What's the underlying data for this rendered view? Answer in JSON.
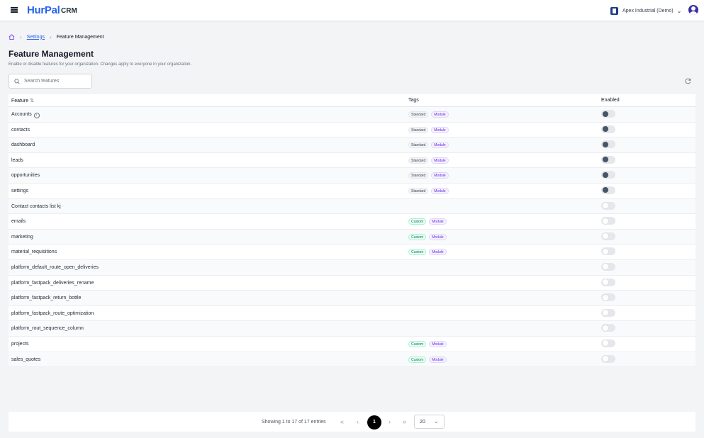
{
  "app": {
    "logo": "HurPal",
    "logo_suffix": "CRM"
  },
  "header": {
    "org_name": "Apex Industrial (Demo)"
  },
  "breadcrumb": {
    "settings": "Settings",
    "current": "Feature Management"
  },
  "page": {
    "title": "Feature Management",
    "subtitle": "Enable or disable features for your organization. Changes apply to everyone in your organization."
  },
  "search": {
    "placeholder": "Search features",
    "value": ""
  },
  "table": {
    "columns": {
      "feature": "Feature",
      "tags": "Tags",
      "enabled": "Enabled"
    },
    "rows": [
      {
        "name": "Accounts",
        "info": true,
        "tags": [
          "Standard",
          "Module"
        ],
        "enabled": true
      },
      {
        "name": "contacts",
        "tags": [
          "Standard",
          "Module"
        ],
        "enabled": true
      },
      {
        "name": "dashboard",
        "tags": [
          "Standard",
          "Module"
        ],
        "enabled": true
      },
      {
        "name": "leads",
        "tags": [
          "Standard",
          "Module"
        ],
        "enabled": true
      },
      {
        "name": "opportunities",
        "tags": [
          "Standard",
          "Module"
        ],
        "enabled": true
      },
      {
        "name": "settings",
        "tags": [
          "Standard",
          "Module"
        ],
        "enabled": true
      },
      {
        "name": "Contact contacts list kj",
        "tags": [],
        "enabled": false
      },
      {
        "name": "emails",
        "tags": [
          "Custom",
          "Module"
        ],
        "enabled": false
      },
      {
        "name": "marketing",
        "tags": [
          "Custom",
          "Module"
        ],
        "enabled": false
      },
      {
        "name": "material_requisitions",
        "tags": [
          "Custom",
          "Module"
        ],
        "enabled": false
      },
      {
        "name": "platform_default_route_open_deliveries",
        "tags": [],
        "enabled": false
      },
      {
        "name": "platform_fastpack_deliveries_rename",
        "tags": [],
        "enabled": false
      },
      {
        "name": "platform_fastpack_return_bottle",
        "tags": [],
        "enabled": false
      },
      {
        "name": "platform_fastpack_route_optimization",
        "tags": [],
        "enabled": false
      },
      {
        "name": "platform_rout_sequence_column",
        "tags": [],
        "enabled": false
      },
      {
        "name": "projects",
        "tags": [
          "Custom",
          "Module"
        ],
        "enabled": false
      },
      {
        "name": "sales_quotes",
        "tags": [
          "Custom",
          "Module"
        ],
        "enabled": false
      }
    ]
  },
  "pagination": {
    "showing": "Showing 1 to 17 of 17 entries",
    "current_page": "1",
    "page_size": "20"
  },
  "icons": [
    "menu-icon",
    "home-icon",
    "search-icon",
    "refresh-icon",
    "info-icon",
    "sort-icon",
    "chevron-down-icon",
    "avatar-icon"
  ],
  "colors": {
    "brand": "#2563eb",
    "toggle_on_knob": "#475569",
    "tag_custom": "#047857",
    "tag_module": "#6d28d9"
  }
}
